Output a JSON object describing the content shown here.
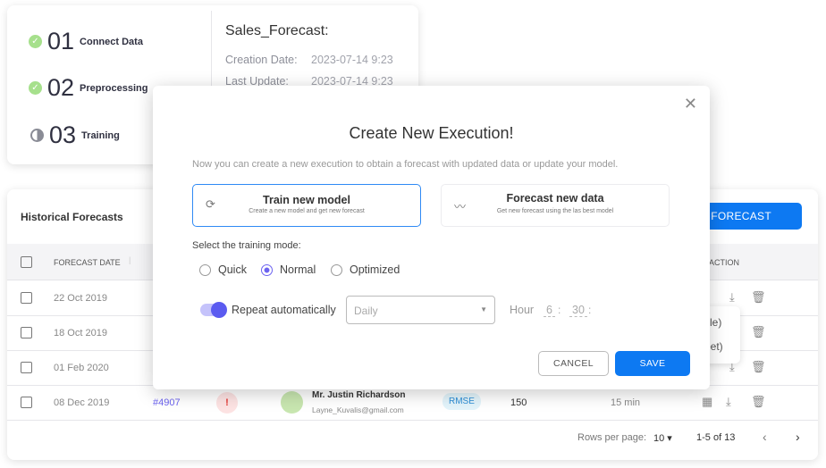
{
  "steps": [
    {
      "num": "01",
      "label": "Connect Data",
      "status": "done"
    },
    {
      "num": "02",
      "label": "Preprocessing",
      "status": "done"
    },
    {
      "num": "03",
      "label": "Training",
      "status": "in-progress"
    }
  ],
  "project": {
    "title": "Sales_Forecast:",
    "creation_label": "Creation Date:",
    "creation_value": "2023-07-14 9:23",
    "update_label": "Last Update:",
    "update_value": "2023-07-14 9:23"
  },
  "table": {
    "title": "Historical Forecasts",
    "forecast_button": "FORECAST",
    "col_date": "FORECAST DATE",
    "col_action": "ACTION",
    "rows": [
      {
        "date": "22 Oct 2019"
      },
      {
        "date": "18 Oct 2019"
      },
      {
        "date": "01 Feb 2020"
      },
      {
        "date": "08 Dec 2019",
        "id": "#4907",
        "name": "Mr. Justin Richardson",
        "email": "Layne_Kuvalis@gmail.com",
        "metric": "RMSE",
        "value": "150",
        "duration": "15 min"
      }
    ],
    "menu_items": [
      "file)",
      "eet)"
    ],
    "rows_per_page_label": "Rows per page:",
    "rows_per_page": "10",
    "range": "1-5 of 13"
  },
  "modal": {
    "title": "Create New Execution!",
    "description": "Now you can create a new execution to obtain a forecast with updated data or update your model.",
    "options": [
      {
        "title": "Train new model",
        "subtitle": "Create a new model and get new forecast",
        "selected": true
      },
      {
        "title": "Forecast new data",
        "subtitle": "Get new forecast using the las best model",
        "selected": false
      }
    ],
    "mode_label": "Select the training mode:",
    "modes": [
      "Quick",
      "Normal",
      "Optimized"
    ],
    "selected_mode": "Normal",
    "repeat_label": "Repeat automatically",
    "repeat_on": true,
    "frequency": "Daily",
    "hour_label": "Hour",
    "hour": "6",
    "minute": "30",
    "cancel": "CANCEL",
    "save": "SAVE"
  },
  "colors": {
    "primary": "#0d79f2",
    "accent": "#5b5bf0",
    "success": "#a6e08c",
    "error": "#e53935"
  }
}
